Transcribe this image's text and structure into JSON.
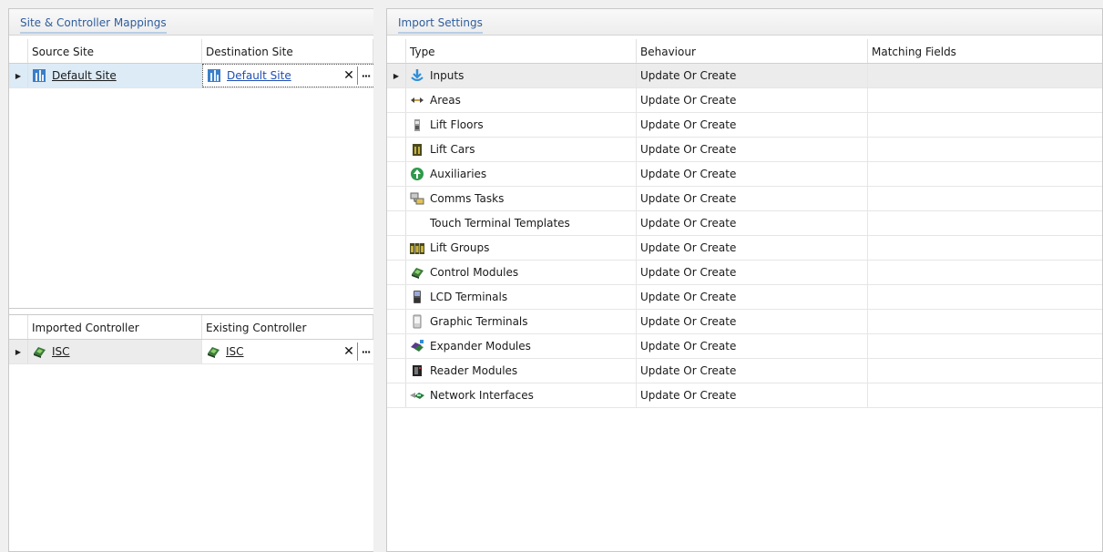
{
  "site_panel": {
    "title": "Site & Controller Mappings",
    "site_grid": {
      "columns": [
        "Source Site",
        "Destination Site"
      ],
      "row": {
        "source": "Default Site",
        "destination": "Default Site"
      }
    },
    "controller_grid": {
      "columns": [
        "Imported Controller",
        "Existing Controller"
      ],
      "row": {
        "imported": "ISC",
        "existing": "ISC"
      }
    },
    "clear_glyph": "✕",
    "more_glyph": "···"
  },
  "import_panel": {
    "title": "Import Settings",
    "columns": [
      "Type",
      "Behaviour",
      "Matching Fields"
    ],
    "rows": [
      {
        "type": "Inputs",
        "behaviour": "Update Or Create",
        "icon": "inputs-icon"
      },
      {
        "type": "Areas",
        "behaviour": "Update Or Create",
        "icon": "areas-icon"
      },
      {
        "type": "Lift Floors",
        "behaviour": "Update Or Create",
        "icon": "lift-floors-icon"
      },
      {
        "type": "Lift Cars",
        "behaviour": "Update Or Create",
        "icon": "lift-cars-icon"
      },
      {
        "type": "Auxiliaries",
        "behaviour": "Update Or Create",
        "icon": "auxiliaries-icon"
      },
      {
        "type": "Comms Tasks",
        "behaviour": "Update Or Create",
        "icon": "comms-tasks-icon"
      },
      {
        "type": "Touch Terminal Templates",
        "behaviour": "Update Or Create",
        "icon": ""
      },
      {
        "type": "Lift Groups",
        "behaviour": "Update Or Create",
        "icon": "lift-groups-icon"
      },
      {
        "type": "Control Modules",
        "behaviour": "Update Or Create",
        "icon": "control-modules-icon"
      },
      {
        "type": "LCD Terminals",
        "behaviour": "Update Or Create",
        "icon": "lcd-terminals-icon"
      },
      {
        "type": "Graphic Terminals",
        "behaviour": "Update Or Create",
        "icon": "graphic-terminals-icon"
      },
      {
        "type": "Expander Modules",
        "behaviour": "Update Or Create",
        "icon": "expander-modules-icon"
      },
      {
        "type": "Reader Modules",
        "behaviour": "Update Or Create",
        "icon": "reader-modules-icon"
      },
      {
        "type": "Network Interfaces",
        "behaviour": "Update Or Create",
        "icon": "network-interfaces-icon"
      }
    ]
  },
  "colors": {
    "header_text": "#2f5d9e",
    "selected_row": "#ddebf7",
    "link_blue": "#1f4fb4"
  }
}
